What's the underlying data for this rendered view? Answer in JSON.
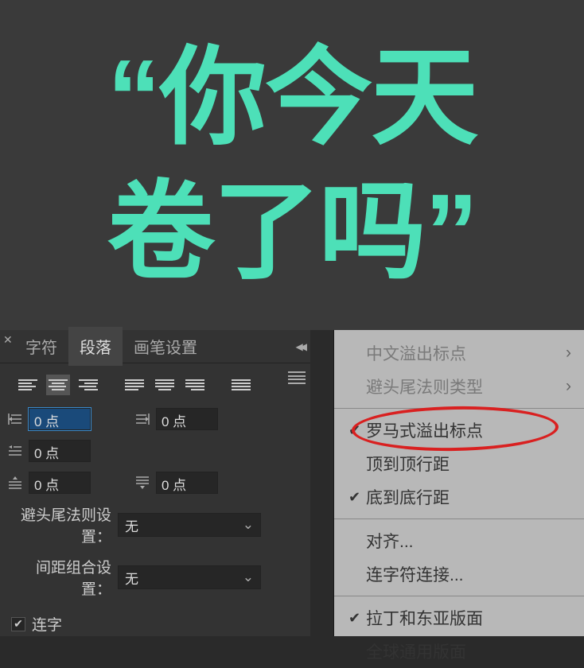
{
  "canvas": {
    "text_line1": "“你今天",
    "text_line2": "卷了吗”",
    "text_color": "#4de0b8"
  },
  "panel": {
    "tabs": [
      {
        "label": "字符",
        "active": false
      },
      {
        "label": "段落",
        "active": true
      },
      {
        "label": "画笔设置",
        "active": false
      }
    ],
    "indent_left": "0 点",
    "indent_right": "0 点",
    "first_line": "0 点",
    "space_before": "0 点",
    "space_after": "0 点",
    "kinsoku_label": "避头尾法则设置：",
    "kinsoku_value": "无",
    "mojikumi_label": "间距组合设置：",
    "mojikumi_value": "无",
    "hyphenate_label": "连字"
  },
  "menu": {
    "items": [
      {
        "label": "中文溢出标点",
        "disabled": true,
        "submenu": true
      },
      {
        "label": "避头尾法则类型",
        "disabled": true,
        "submenu": true
      },
      {
        "divider": true
      },
      {
        "label": "罗马式溢出标点",
        "checked": true,
        "highlighted": true
      },
      {
        "label": "顶到顶行距"
      },
      {
        "label": "底到底行距",
        "checked": true
      },
      {
        "divider": true
      },
      {
        "label": "对齐..."
      },
      {
        "label": "连字符连接..."
      },
      {
        "divider": true
      },
      {
        "label": "拉丁和东亚版面",
        "checked": true
      },
      {
        "label": "全球通用版面"
      }
    ]
  }
}
